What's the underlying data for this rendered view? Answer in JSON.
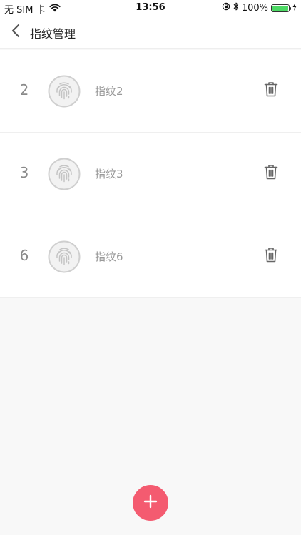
{
  "status_bar": {
    "carrier": "无 SIM 卡",
    "time": "13:56",
    "battery_percent": "100%",
    "battery_level": 1.0
  },
  "nav": {
    "title": "指纹管理"
  },
  "fingerprints": [
    {
      "index": "2",
      "label": "指纹2"
    },
    {
      "index": "3",
      "label": "指纹3"
    },
    {
      "index": "6",
      "label": "指纹6"
    }
  ],
  "colors": {
    "accent": "#f45b70",
    "background": "#f8f8f8",
    "card": "#ffffff",
    "battery": "#4cd964"
  },
  "icons": {
    "back": "chevron-left-icon",
    "fingerprint": "fingerprint-icon",
    "delete": "trash-icon",
    "add": "plus-icon"
  }
}
